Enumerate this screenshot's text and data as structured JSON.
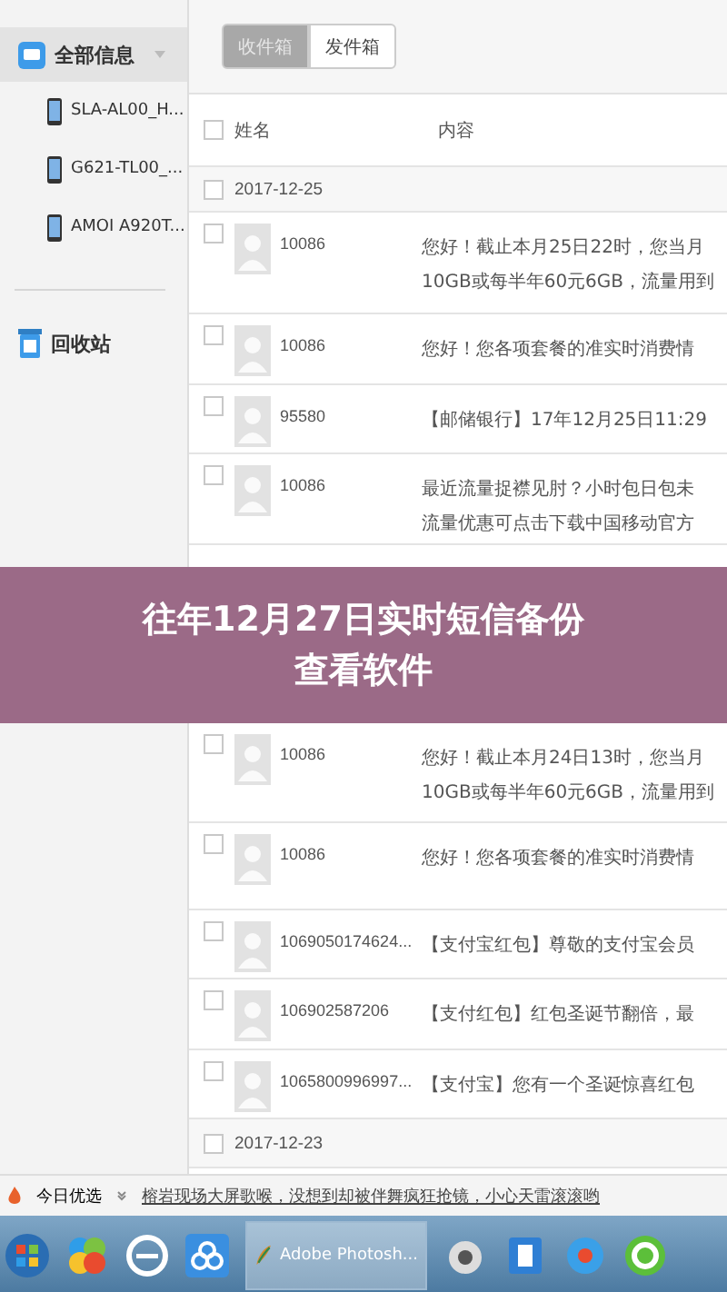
{
  "sidebar": {
    "items": [
      {
        "kind": "group",
        "label": "全部信息",
        "selected": true
      },
      {
        "kind": "device",
        "label": "SLA-AL00_H...",
        "selected": false
      },
      {
        "kind": "device",
        "label": "G621-TL00_...",
        "selected": false
      },
      {
        "kind": "device",
        "label": "AMOI A920T...",
        "selected": false
      }
    ],
    "trash": {
      "label": "回收站"
    }
  },
  "tabs": [
    {
      "label": "收件箱",
      "selected": true
    },
    {
      "label": "发件箱",
      "selected": false
    }
  ],
  "table": {
    "header_checked": false,
    "columns": [
      {
        "label": "姓名"
      },
      {
        "label": "内容"
      }
    ],
    "rows_top": [
      {
        "kind": "date",
        "date": "2017-12-25",
        "checked": false
      },
      {
        "kind": "message",
        "sender": "10086",
        "lines": [
          "您好！截止本月25日22时，您当月",
          "10GB或每半年60元6GB，流量用到"
        ],
        "checked": false
      },
      {
        "kind": "message",
        "sender": "10086",
        "lines": [
          "您好！您各项套餐的准实时消费情"
        ],
        "checked": false
      },
      {
        "kind": "message",
        "sender": "95580",
        "lines": [
          "【邮储银行】17年12月25日11:29"
        ],
        "checked": false
      },
      {
        "kind": "message",
        "sender": "10086",
        "lines": [
          "最近流量捉襟见肘？小时包日包未",
          "流量优惠可点击下载中国移动官方"
        ],
        "checked": false
      }
    ],
    "rows_bottom": [
      {
        "kind": "message",
        "sender": "10086",
        "lines": [
          "您好！截止本月24日13时，您当月",
          "10GB或每半年60元6GB，流量用到"
        ],
        "checked": false
      },
      {
        "kind": "message",
        "sender": "10086",
        "lines": [
          "您好！您各项套餐的准实时消费情"
        ],
        "checked": false
      },
      {
        "kind": "message",
        "sender": "1069050174624...",
        "lines": [
          "【支付宝红包】尊敬的支付宝会员"
        ],
        "checked": false
      },
      {
        "kind": "message",
        "sender": "106902587206",
        "lines": [
          "【支付红包】红包圣诞节翻倍，最"
        ],
        "checked": false
      },
      {
        "kind": "message",
        "sender": "1065800996997...",
        "lines": [
          "【支付宝】您有一个圣诞惊喜红包"
        ],
        "checked": false
      },
      {
        "kind": "date",
        "date": "2017-12-23",
        "checked": false
      }
    ]
  },
  "banner": {
    "title_lines": [
      "往年12月27日实时短信备份",
      "查看软件"
    ]
  },
  "news_bar": {
    "label": "今日优选",
    "link": "榕岩现场大屏歌喉，没想到却被伴舞疯狂抢镜，小心天雷滚滚哟"
  },
  "taskbar": {
    "window_label": "Adobe Photosh..."
  }
}
